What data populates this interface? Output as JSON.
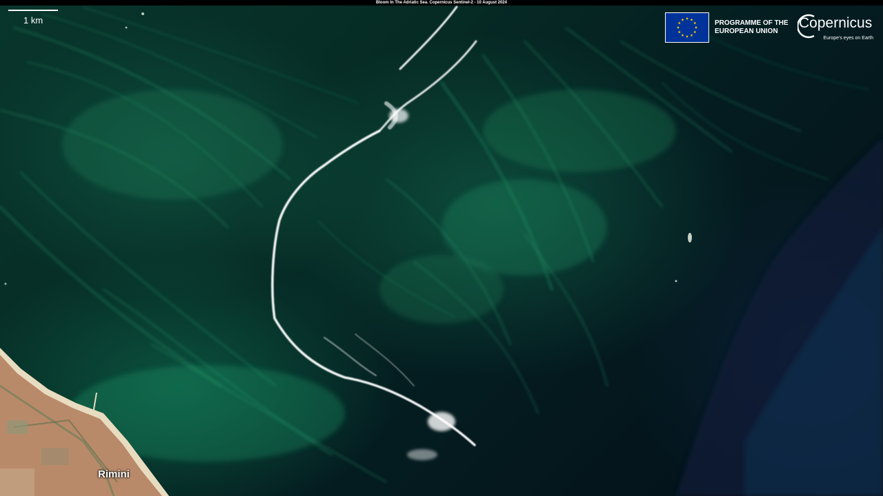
{
  "caption": "Bloom In The Adriatic Sea. Copernicus Sentinel-2 - 10 August 2024",
  "scale_bar": {
    "label": "1 km"
  },
  "logos": {
    "programme_line1": "PROGRAMME OF THE",
    "programme_line2": "EUROPEAN UNION",
    "brand": "Copernicus",
    "tagline": "Europe's eyes on Earth"
  },
  "place_labels": {
    "city": "Rimini"
  },
  "colors": {
    "algae_bloom": "#1f8a5e",
    "deep_water": "#03111a",
    "foam_front": "#ffffff",
    "coast_sand": "#e8dcc0",
    "urban": "#b98a6a",
    "eu_blue": "#003399",
    "eu_star": "#ffcc00"
  }
}
